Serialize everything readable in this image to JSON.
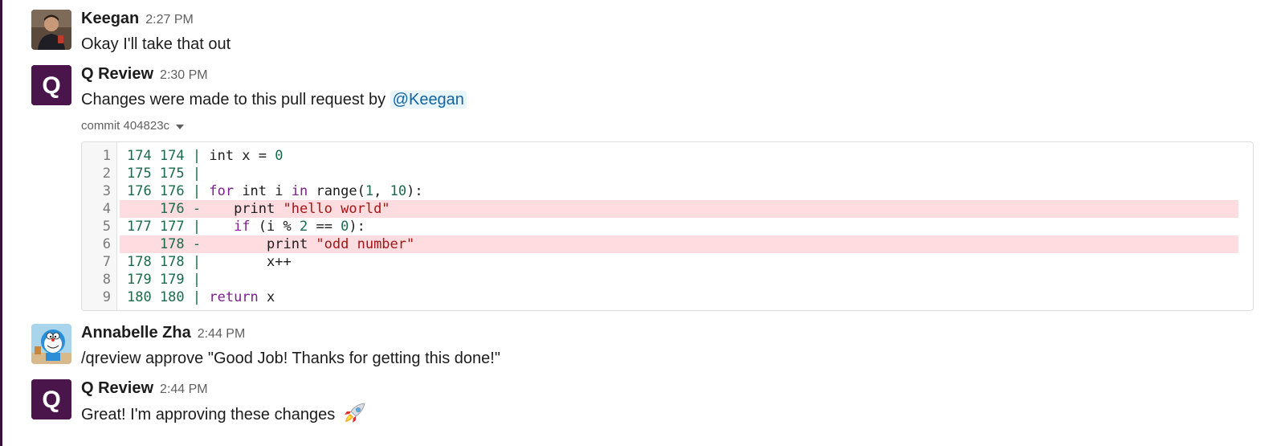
{
  "messages": [
    {
      "sender": "Keegan",
      "time": "2:27 PM",
      "text": "Okay I'll take that out",
      "avatar_icon": "person-avatar-photo"
    },
    {
      "sender": "Q Review",
      "time": "2:30 PM",
      "text": "Changes were made to this pull request by",
      "mention": "@Keegan",
      "avatar_icon": "q-review-logo",
      "commit_label": "commit 404823c",
      "code_lines": [
        {
          "ln": "1",
          "segments": [
            {
              "t": "174 174 | ",
              "c": "num"
            },
            {
              "t": "int x = ",
              "c": ""
            },
            {
              "t": "0",
              "c": "num"
            }
          ],
          "removed": false
        },
        {
          "ln": "2",
          "segments": [
            {
              "t": "175 175 |",
              "c": "num"
            }
          ],
          "removed": false
        },
        {
          "ln": "3",
          "segments": [
            {
              "t": "176 176 | ",
              "c": "num"
            },
            {
              "t": "for",
              "c": "kw"
            },
            {
              "t": " int i ",
              "c": ""
            },
            {
              "t": "in",
              "c": "kw"
            },
            {
              "t": " range(",
              "c": ""
            },
            {
              "t": "1",
              "c": "num"
            },
            {
              "t": ", ",
              "c": ""
            },
            {
              "t": "10",
              "c": "num"
            },
            {
              "t": "):",
              "c": ""
            }
          ],
          "removed": false
        },
        {
          "ln": "4",
          "segments": [
            {
              "t": "    176 -    ",
              "c": "num"
            },
            {
              "t": "print ",
              "c": ""
            },
            {
              "t": "\"hello world\"",
              "c": "str"
            }
          ],
          "removed": true
        },
        {
          "ln": "5",
          "segments": [
            {
              "t": "177 177 |    ",
              "c": "num"
            },
            {
              "t": "if",
              "c": "kw"
            },
            {
              "t": " (i % ",
              "c": ""
            },
            {
              "t": "2",
              "c": "num"
            },
            {
              "t": " == ",
              "c": ""
            },
            {
              "t": "0",
              "c": "num"
            },
            {
              "t": "):",
              "c": ""
            }
          ],
          "removed": false
        },
        {
          "ln": "6",
          "segments": [
            {
              "t": "    178 -        ",
              "c": "num"
            },
            {
              "t": "print ",
              "c": ""
            },
            {
              "t": "\"odd number\"",
              "c": "str"
            }
          ],
          "removed": true
        },
        {
          "ln": "7",
          "segments": [
            {
              "t": "178 178 |        ",
              "c": "num"
            },
            {
              "t": "x++",
              "c": ""
            }
          ],
          "removed": false
        },
        {
          "ln": "8",
          "segments": [
            {
              "t": "179 179 |",
              "c": "num"
            }
          ],
          "removed": false
        },
        {
          "ln": "9",
          "segments": [
            {
              "t": "180 180 | ",
              "c": "num"
            },
            {
              "t": "return",
              "c": "kw"
            },
            {
              "t": " x",
              "c": ""
            }
          ],
          "removed": false
        }
      ]
    },
    {
      "sender": "Annabelle Zha",
      "time": "2:44 PM",
      "text": "/qreview approve \"Good Job! Thanks for getting this done!\"",
      "avatar_icon": "cartoon-cat-avatar"
    },
    {
      "sender": "Q Review",
      "time": "2:44 PM",
      "text": "Great! I'm approving these changes",
      "avatar_icon": "q-review-logo",
      "emoji": "rocket-emoji"
    }
  ],
  "logo_letter": "Q",
  "colors": {
    "brand_aubergine": "#4a154b",
    "mention_bg": "#e8f5fa",
    "mention_text": "#1264a3",
    "removed_line_bg": "#ffdce0",
    "number_green": "#1a6b4a",
    "keyword_purple": "#7a1f8c",
    "string_red": "#a31515"
  }
}
